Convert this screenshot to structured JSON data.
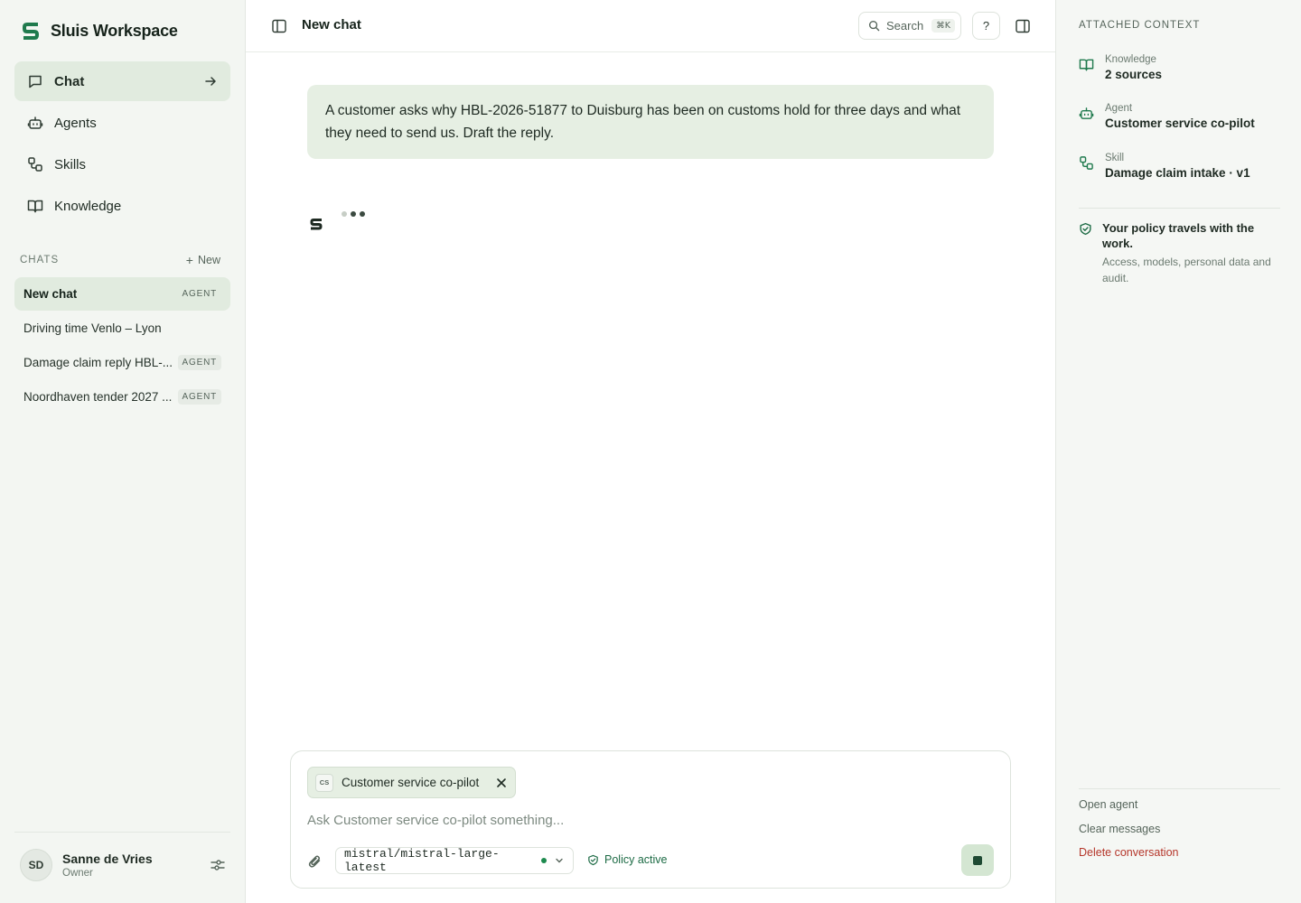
{
  "workspace": {
    "name": "Sluis Workspace"
  },
  "nav": [
    {
      "label": "Chat",
      "icon": "chat-bubble-icon",
      "active": true
    },
    {
      "label": "Agents",
      "icon": "robot-icon"
    },
    {
      "label": "Skills",
      "icon": "workflow-icon"
    },
    {
      "label": "Knowledge",
      "icon": "book-icon"
    }
  ],
  "chats": {
    "heading": "CHATS",
    "new_label": "New",
    "items": [
      {
        "title": "New chat",
        "tag": "AGENT",
        "active": true
      },
      {
        "title": "Driving time Venlo – Lyon",
        "tag": ""
      },
      {
        "title": "Damage claim reply HBL-...",
        "tag": "AGENT"
      },
      {
        "title": "Noordhaven tender 2027 ...",
        "tag": "AGENT"
      }
    ]
  },
  "user": {
    "initials": "SD",
    "name": "Sanne de Vries",
    "role": "Owner"
  },
  "header": {
    "title": "New chat",
    "search_label": "Search",
    "search_shortcut": "⌘K",
    "help_label": "?"
  },
  "conversation": {
    "user_message": "A customer asks why HBL-2026-51877 to Duisburg has been on customs hold for three days and what they need to send us. Draft the reply."
  },
  "composer": {
    "agent_chip": {
      "badge": "CS",
      "label": "Customer service co-pilot"
    },
    "placeholder": "Ask Customer service co-pilot something...",
    "value": "",
    "model": "mistral/mistral-large-latest",
    "policy_label": "Policy active"
  },
  "context_panel": {
    "title": "ATTACHED CONTEXT",
    "knowledge": {
      "label": "Knowledge",
      "value": "2 sources"
    },
    "agent": {
      "label": "Agent",
      "value": "Customer service co-pilot"
    },
    "skill": {
      "label": "Skill",
      "value": "Damage claim intake · v1"
    },
    "policy": {
      "title": "Your policy travels with the work.",
      "body": "Access, models, personal data and audit."
    },
    "actions": {
      "open_agent": "Open agent",
      "clear_messages": "Clear messages",
      "delete_conversation": "Delete conversation"
    }
  },
  "colors": {
    "brand": "#1f7a4d",
    "active_bg": "#e1ebdf",
    "message_bg": "#e6efe3",
    "policy_green": "#1d6b45",
    "danger": "#b5372b"
  }
}
